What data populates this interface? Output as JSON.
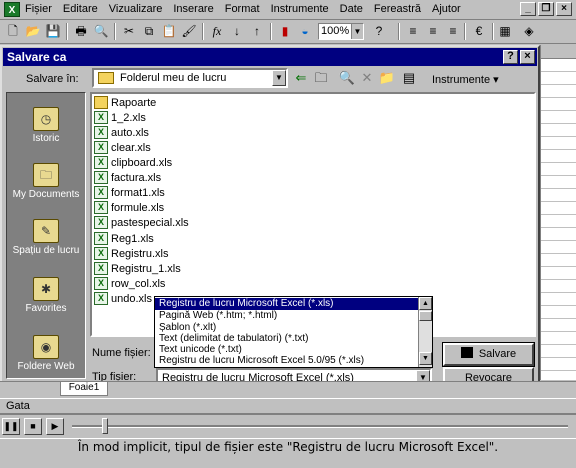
{
  "menubar": {
    "app_icon": "excel-icon",
    "items": [
      "Fișier",
      "Editare",
      "Vizualizare",
      "Inserare",
      "Format",
      "Instrumente",
      "Date",
      "Fereastră",
      "Ajutor"
    ],
    "underline_first": [
      "F",
      "E",
      "V",
      "I",
      "o",
      "n",
      "D",
      "F",
      "j"
    ]
  },
  "toolbar": {
    "zoom": "100%"
  },
  "dialog": {
    "title": "Salvare ca",
    "help_btn": "?",
    "close_btn": "×",
    "save_in_label": "Salvare în:",
    "save_in_value": "Folderul meu de lucru",
    "tools_label": "Instrumente",
    "places": [
      {
        "label": "Istoric",
        "icon": "history-icon"
      },
      {
        "label": "My Documents",
        "icon": "my-documents-icon"
      },
      {
        "label": "Spațiu de lucru",
        "icon": "desktop-icon"
      },
      {
        "label": "Favorites",
        "icon": "favorites-icon"
      },
      {
        "label": "Foldere Web",
        "icon": "web-folders-icon"
      }
    ],
    "files": [
      {
        "name": "Rapoarte",
        "type": "folder"
      },
      {
        "name": "1_2.xls",
        "type": "xls"
      },
      {
        "name": "auto.xls",
        "type": "xls"
      },
      {
        "name": "clear.xls",
        "type": "xls"
      },
      {
        "name": "clipboard.xls",
        "type": "xls"
      },
      {
        "name": "factura.xls",
        "type": "xls"
      },
      {
        "name": "format1.xls",
        "type": "xls"
      },
      {
        "name": "formule.xls",
        "type": "xls"
      },
      {
        "name": "pastespecial.xls",
        "type": "xls"
      },
      {
        "name": "Reg1.xls",
        "type": "xls"
      },
      {
        "name": "Registru.xls",
        "type": "xls"
      },
      {
        "name": "Registru_1.xls",
        "type": "xls"
      },
      {
        "name": "row_col.xls",
        "type": "xls"
      },
      {
        "name": "undo.xls",
        "type": "xls"
      }
    ],
    "file_name_label": "Nume fișier:",
    "file_type_label": "Tip fișier:",
    "file_type_options": [
      "Registru de lucru Microsoft Excel (*.xls)",
      "Pagină Web (*.htm; *.html)",
      "Șablon (*.xlt)",
      "Text (delimitat de tabulatori) (*.txt)",
      "Text unicode (*.txt)",
      "Registru de lucru Microsoft Excel 5.0/95 (*.xls)"
    ],
    "file_type_selected_index": 0,
    "file_type_value": "Registru de lucru Microsoft Excel (*.xls)",
    "save_button": "Salvare",
    "cancel_button": "Revocare"
  },
  "sheet": {
    "tab_label": "Foaie1"
  },
  "status": {
    "text": "Gata"
  },
  "player": {
    "progress": 0.06
  },
  "caption": "În mod implicit, tipul de fișier este \"Registru de lucru Microsoft Excel\"."
}
